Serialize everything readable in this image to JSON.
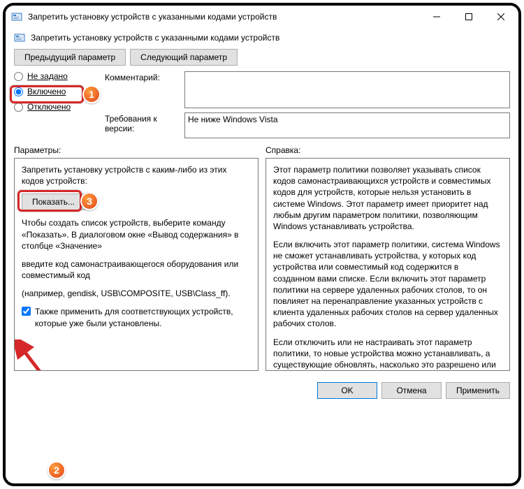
{
  "window": {
    "title": "Запретить установку устройств с указанными кодами устройств"
  },
  "header": {
    "title": "Запретить установку устройств с указанными кодами устройств"
  },
  "nav": {
    "prev": "Предыдущий параметр",
    "next": "Следующий параметр"
  },
  "radios": {
    "not_configured": "Не задано",
    "enabled": "Включено",
    "disabled": "Отключено"
  },
  "labels": {
    "comment": "Комментарий:",
    "requirements": "Требования к версии:",
    "params": "Параметры:",
    "help": "Справка:"
  },
  "fields": {
    "comment_value": "",
    "requirements_value": "Не ниже Windows Vista"
  },
  "params_panel": {
    "intro": "Запретить установку устройств с каким-либо из этих кодов устройств:",
    "show_btn": "Показать...",
    "p1": "Чтобы создать список устройств, выберите команду «Показать». В диалоговом окне «Вывод содержания» в столбце «Значение»",
    "p2": "введите код самонастраивающегося оборудования или совместимый код",
    "p3": "(например, gendisk, USB\\COMPOSITE, USB\\Class_ff).",
    "chk_label": "Также применить для соответствующих устройств, которые уже были установлены."
  },
  "help_panel": {
    "p1": "Этот параметр политики позволяет указывать список кодов самонастраивающихся устройств и совместимых кодов для устройств, которые нельзя установить в системе Windows. Этот параметр имеет приоритет над любым другим параметром политики, позволяющим Windows устанавливать устройства.",
    "p2": "Если включить этот параметр политики, система Windows не сможет устанавливать устройства, у которых код устройства или совместимый код содержится в созданном вами списке. Если включить этот параметр политики на сервере удаленных рабочих столов, то он повлияет на перенаправление указанных устройств с клиента удаленных рабочих столов на сервер удаленных рабочих столов.",
    "p3": "Если отключить или не настраивать этот параметр политики, то новые устройства можно устанавливать, а существующие обновлять, насколько это разрешено или запрещено другими параметрами политики."
  },
  "footer": {
    "ok": "OK",
    "cancel": "Отмена",
    "apply": "Применить"
  }
}
